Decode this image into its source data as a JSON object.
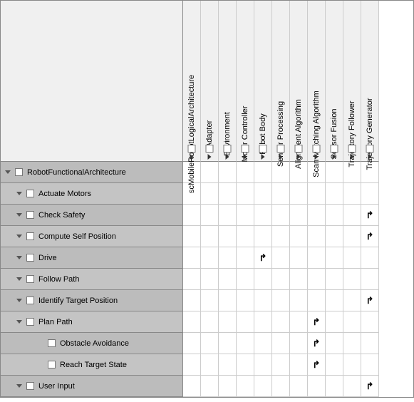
{
  "columns": [
    {
      "label": "scMobileRobotLogicalArchitecture",
      "hasExpand": true
    },
    {
      "label": "Adapter",
      "hasExpand": true
    },
    {
      "label": "Environment",
      "hasExpand": true
    },
    {
      "label": "Motor Controller",
      "hasExpand": true
    },
    {
      "label": "Robot Body",
      "hasExpand": true
    },
    {
      "label": "Sensor Processing",
      "hasExpand": true
    },
    {
      "label": "Alignment Algorithm",
      "hasExpand": true
    },
    {
      "label": "Scan Matching Algorithm",
      "hasExpand": true
    },
    {
      "label": "Sensor Fusion",
      "hasExpand": true
    },
    {
      "label": "Trajectory Follower",
      "hasExpand": true
    },
    {
      "label": "Trajectory Generator",
      "hasExpand": true
    }
  ],
  "rows": [
    {
      "label": "RobotFunctionalArchitecture",
      "indent": 0,
      "hasExpand": true,
      "marks": []
    },
    {
      "label": "Actuate Motors",
      "indent": 1,
      "hasExpand": true,
      "marks": []
    },
    {
      "label": "Check Safety",
      "indent": 1,
      "hasExpand": true,
      "marks": [
        10
      ]
    },
    {
      "label": "Compute Self Position",
      "indent": 1,
      "hasExpand": true,
      "marks": [
        10
      ]
    },
    {
      "label": "Drive",
      "indent": 1,
      "hasExpand": true,
      "marks": [
        4
      ]
    },
    {
      "label": "Follow Path",
      "indent": 1,
      "hasExpand": true,
      "marks": []
    },
    {
      "label": "Identify Target Position",
      "indent": 1,
      "hasExpand": true,
      "marks": [
        10
      ]
    },
    {
      "label": "Plan Path",
      "indent": 1,
      "hasExpand": true,
      "marks": [
        7
      ]
    },
    {
      "label": "Obstacle Avoidance",
      "indent": 2,
      "hasExpand": false,
      "marks": [
        7
      ]
    },
    {
      "label": "Reach Target State",
      "indent": 2,
      "hasExpand": false,
      "marks": [
        7
      ]
    },
    {
      "label": "User Input",
      "indent": 1,
      "hasExpand": true,
      "marks": [
        10
      ]
    }
  ],
  "mark_glyph": "↱"
}
